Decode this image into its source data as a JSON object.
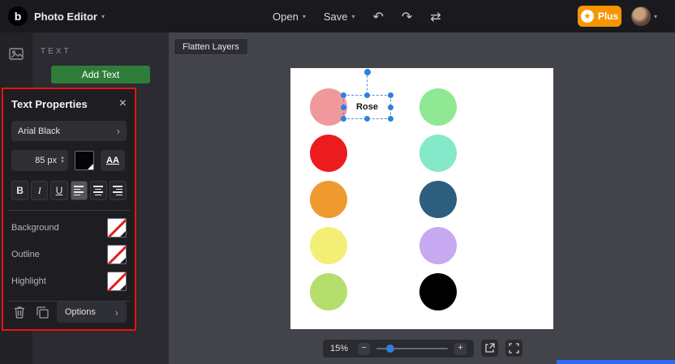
{
  "topbar": {
    "app_name": "Photo Editor",
    "open_label": "Open",
    "save_label": "Save",
    "undo_glyph": "↶",
    "redo_glyph": "↷",
    "reset_glyph": "⇄",
    "plus_label": "Plus"
  },
  "left_panel": {
    "section_title": "TEXT",
    "add_text_label": "Add Text"
  },
  "text_properties": {
    "title": "Text Properties",
    "close_glyph": "×",
    "font_name": "Arial Black",
    "font_size": "85 px",
    "case_button": "AA",
    "bold": "B",
    "italic": "I",
    "underline": "U",
    "swatch_rows": [
      {
        "label": "Background"
      },
      {
        "label": "Outline"
      },
      {
        "label": "Highlight"
      }
    ],
    "options_label": "Options"
  },
  "canvas": {
    "flatten_label": "Flatten Layers",
    "selected_text": "Rose",
    "circle_rows": [
      {
        "left": "#f0999c",
        "right": "#8fe894"
      },
      {
        "left": "#ec1c1e",
        "right": "#85e9c9"
      },
      {
        "left": "#f0992f",
        "right": "#2d5e7e"
      },
      {
        "left": "#f3ef76",
        "right": "#c6a9f1"
      },
      {
        "left": "#b4df6d",
        "right": "#000000"
      }
    ]
  },
  "zoom_bar": {
    "zoom_level": "15%",
    "decrease_label": "−",
    "increase_label": "+"
  },
  "colors": {
    "accent_orange": "#f79500",
    "accent_green": "#2e7d3a",
    "selection_blue": "#2f7fe0",
    "highlight_red": "#ee1111",
    "scrollbar_blue": "#2b6cf6"
  }
}
